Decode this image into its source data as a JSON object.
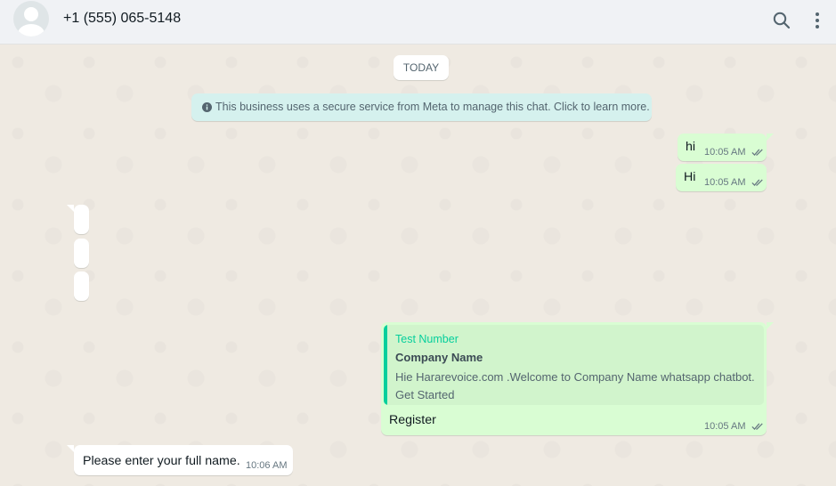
{
  "header": {
    "contact_name": "+1 (555) 065-5148",
    "icons": [
      "search-icon",
      "more-vertical-icon"
    ]
  },
  "chat": {
    "date_chip": "TODAY",
    "system_message": "This business uses a secure service from Meta to manage this chat. Click to learn more.",
    "messages": [
      {
        "direction": "outgoing",
        "text": "hi",
        "time": "10:05 AM",
        "status": "read"
      },
      {
        "direction": "outgoing",
        "text": "Hi",
        "time": "10:05 AM",
        "status": "read"
      },
      {
        "direction": "outgoing",
        "quote": {
          "author": "Test Number",
          "title": "Company Name",
          "body": "Hie Hararevoice.com .Welcome to Company Name whatsapp chatbot. Get Started"
        },
        "text": "Register",
        "time": "10:05 AM",
        "status": "read"
      },
      {
        "direction": "incoming",
        "text": "Please enter your full name.",
        "time": "10:06 AM"
      }
    ]
  },
  "colors": {
    "outgoing_bubble": "#d9fdd3",
    "incoming_bubble": "#ffffff",
    "chat_background": "#efeae2",
    "system_message_bg": "#d5f1ee",
    "quote_accent": "#06cf9c",
    "read_ticks": "#667781"
  }
}
